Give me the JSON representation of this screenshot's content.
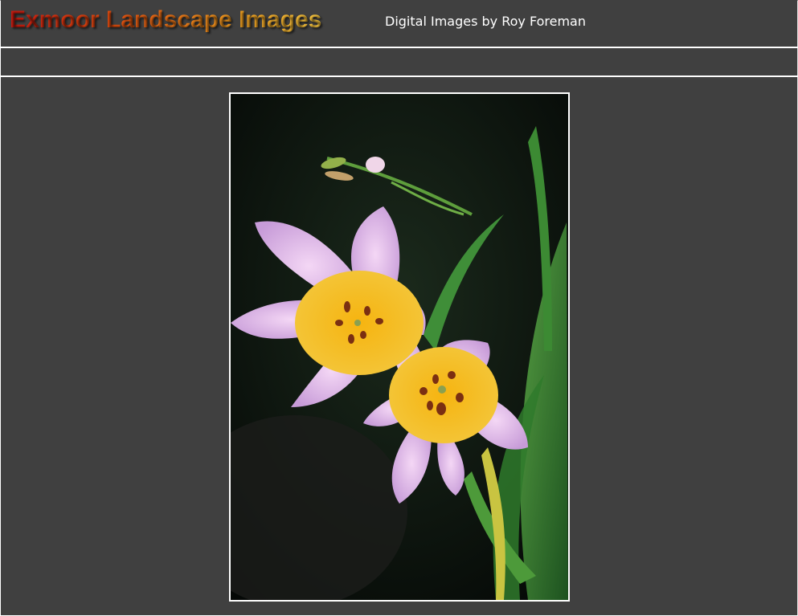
{
  "header": {
    "title": "Exmoor Landscape Images",
    "subtitle": "Digital Images by Roy Foreman"
  },
  "photo": {
    "subject": "flower-photo"
  }
}
